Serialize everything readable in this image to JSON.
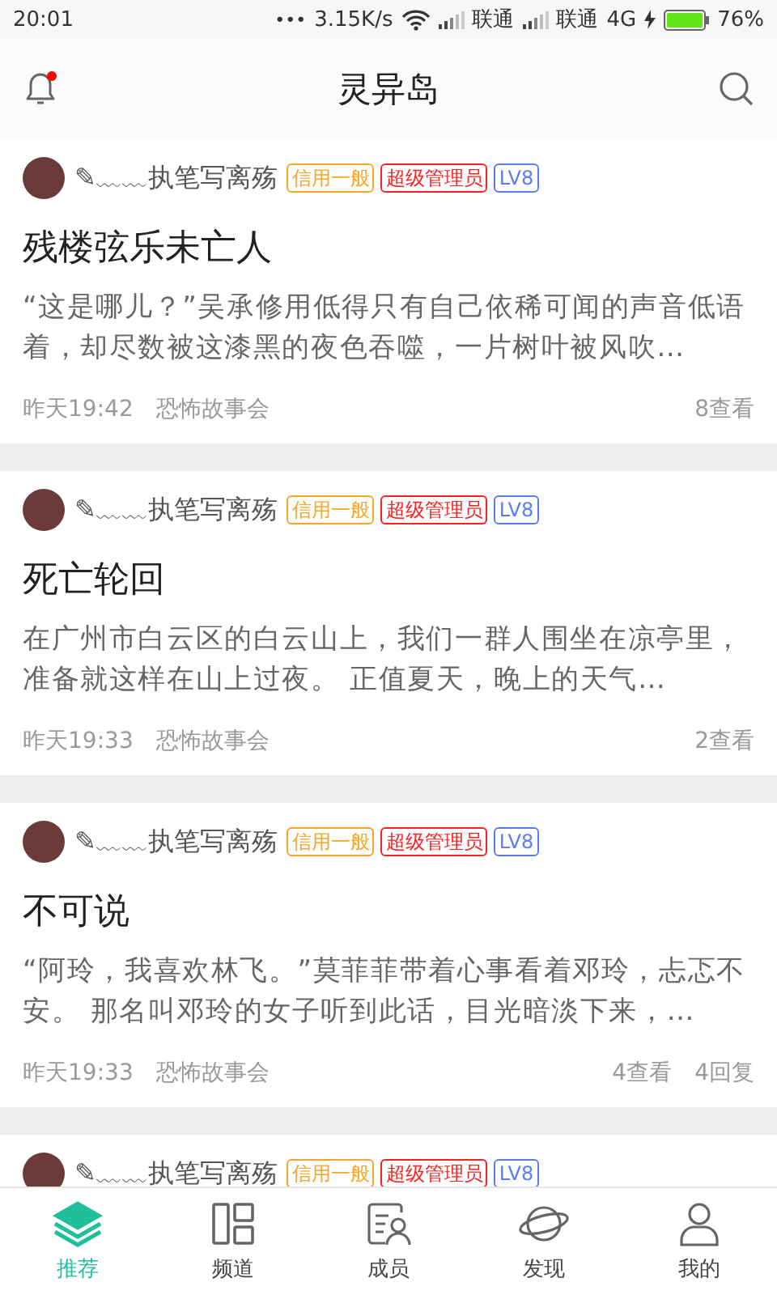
{
  "status_bar": {
    "time": "20:01",
    "dots": "•••",
    "speed": "3.15K/s",
    "carriers": [
      {
        "name": "联通"
      },
      {
        "name": "联通",
        "network": "4G"
      }
    ],
    "battery": "76%"
  },
  "header": {
    "title": "灵异岛",
    "has_notification": true
  },
  "posts": [
    {
      "author": "✎﹏﹏执笔写离殇",
      "badges": [
        {
          "text": "信用一般",
          "color": "#f5a623"
        },
        {
          "text": "超级管理员",
          "color": "#ff2020"
        },
        {
          "text": "LV8",
          "color": "#5a7cf5"
        }
      ],
      "title": "残楼弦乐未亡人",
      "excerpt": "“这是哪儿？”吴承修用低得只有自己依稀可闻的声音低语着，却尽数被这漆黑的夜色吞噬，一片树叶被风吹…",
      "time": "昨天19:42",
      "forum": "恐怖故事会",
      "stats": [
        "8查看"
      ]
    },
    {
      "author": "✎﹏﹏执笔写离殇",
      "badges": [
        {
          "text": "信用一般",
          "color": "#f5a623"
        },
        {
          "text": "超级管理员",
          "color": "#ff2020"
        },
        {
          "text": "LV8",
          "color": "#5a7cf5"
        }
      ],
      "title": "死亡轮回",
      "excerpt": "在广州市白云区的白云山上，我们一群人围坐在凉亭里，准备就这样在山上过夜。 正值夏天，晚上的天气…",
      "time": "昨天19:33",
      "forum": "恐怖故事会",
      "stats": [
        "2查看"
      ]
    },
    {
      "author": "✎﹏﹏执笔写离殇",
      "badges": [
        {
          "text": "信用一般",
          "color": "#f5a623"
        },
        {
          "text": "超级管理员",
          "color": "#ff2020"
        },
        {
          "text": "LV8",
          "color": "#5a7cf5"
        }
      ],
      "title": "不可说",
      "excerpt": "“阿玲，我喜欢林飞。”莫菲菲带着心事看着邓玲，忐忑不安。 那名叫邓玲的女子听到此话，目光暗淡下来，…",
      "time": "昨天19:33",
      "forum": "恐怖故事会",
      "stats": [
        "4查看",
        "4回复"
      ]
    },
    {
      "author": "✎﹏﹏执笔写离殇",
      "badges": [
        {
          "text": "信用一般",
          "color": "#f5a623"
        },
        {
          "text": "超级管理员",
          "color": "#ff2020"
        },
        {
          "text": "LV8",
          "color": "#5a7cf5"
        }
      ]
    }
  ],
  "tab_bar": [
    {
      "kind": "layers",
      "label": "推荐",
      "selected": true
    },
    {
      "kind": "channels",
      "label": "频道",
      "selected": false
    },
    {
      "kind": "members",
      "label": "成员",
      "selected": false
    },
    {
      "kind": "planet",
      "label": "发现",
      "selected": false
    },
    {
      "kind": "person",
      "label": "我的",
      "selected": false
    }
  ]
}
